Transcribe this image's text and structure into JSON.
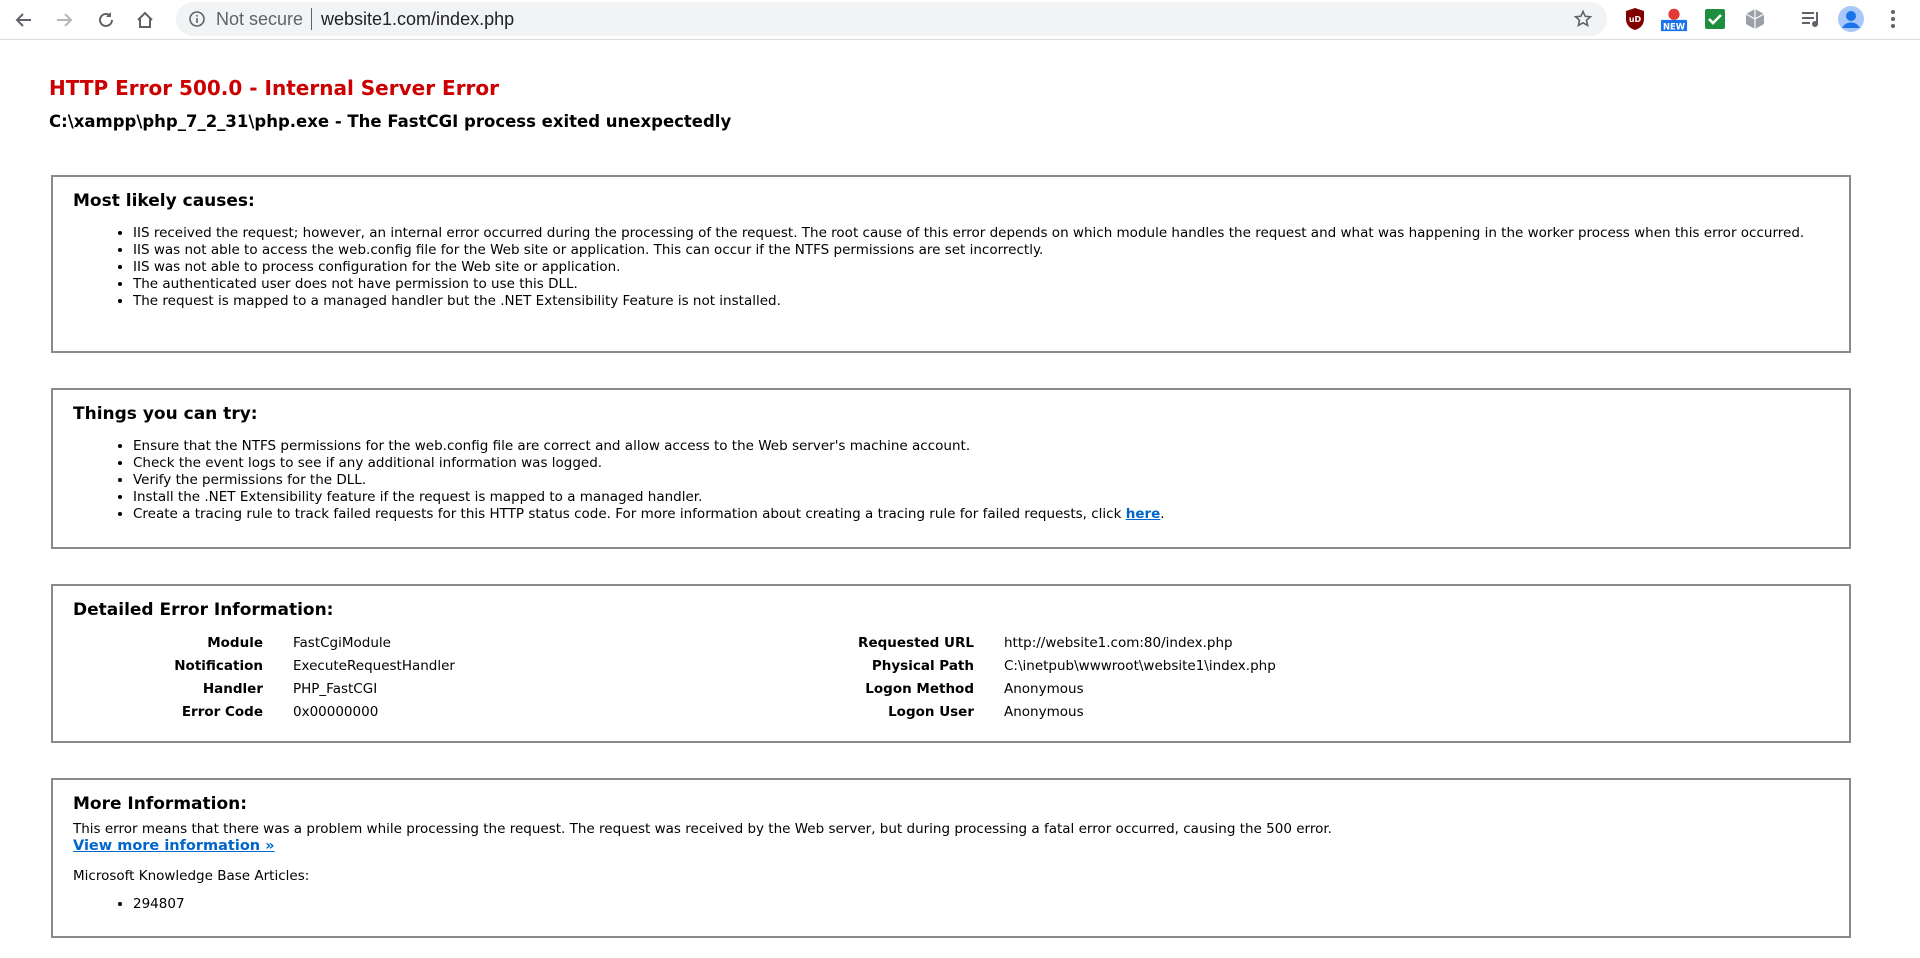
{
  "browser": {
    "omnibox": {
      "security_label": "Not secure",
      "url": "website1.com/index.php"
    },
    "extensions": [
      {
        "name": "ublock-icon"
      },
      {
        "name": "new-badge-icon",
        "badge": "NEW"
      },
      {
        "name": "check-extension-icon"
      },
      {
        "name": "cube-extension-icon"
      },
      {
        "name": "media-queue-icon"
      },
      {
        "name": "profile-avatar-icon"
      }
    ],
    "colors": {
      "accent": "#1a73e8",
      "omnibox_bg": "#f1f3f4"
    }
  },
  "error": {
    "title": "HTTP Error 500.0 - Internal Server Error",
    "subtitle": "C:\\xampp\\php_7_2_31\\php.exe - The FastCGI process exited unexpectedly",
    "title_color": "#cc0000"
  },
  "causes": {
    "heading": "Most likely causes:",
    "items": [
      "IIS received the request; however, an internal error occurred during the processing of the request. The root cause of this error depends on which module handles the request and what was happening in the worker process when this error occurred.",
      "IIS was not able to access the web.config file for the Web site or application. This can occur if the NTFS permissions are set incorrectly.",
      "IIS was not able to process configuration for the Web site or application.",
      "The authenticated user does not have permission to use this DLL.",
      "The request is mapped to a managed handler but the .NET Extensibility Feature is not installed."
    ]
  },
  "tries": {
    "heading": "Things you can try:",
    "items": [
      "Ensure that the NTFS permissions for the web.config file are correct and allow access to the Web server's machine account.",
      "Check the event logs to see if any additional information was logged.",
      "Verify the permissions for the DLL.",
      "Install the .NET Extensibility feature if the request is mapped to a managed handler."
    ],
    "last_item_text": "Create a tracing rule to track failed requests for this HTTP status code. For more information about creating a tracing rule for failed requests, click ",
    "last_item_link": "here",
    "last_item_suffix": "."
  },
  "details": {
    "heading": "Detailed Error Information:",
    "left": [
      {
        "label": "Module",
        "value": "FastCgiModule"
      },
      {
        "label": "Notification",
        "value": "ExecuteRequestHandler"
      },
      {
        "label": "Handler",
        "value": "PHP_FastCGI"
      },
      {
        "label": "Error Code",
        "value": "0x00000000"
      }
    ],
    "right": [
      {
        "label": "Requested URL",
        "value": "http://website1.com:80/index.php"
      },
      {
        "label": "Physical Path",
        "value": "C:\\inetpub\\wwwroot\\website1\\index.php"
      },
      {
        "label": "Logon Method",
        "value": "Anonymous"
      },
      {
        "label": "Logon User",
        "value": "Anonymous"
      }
    ]
  },
  "more": {
    "heading": "More Information:",
    "text": "This error means that there was a problem while processing the request. The request was received by the Web server, but during processing a fatal error occurred, causing the 500 error.",
    "link": "View more information »",
    "kb_label": "Microsoft Knowledge Base Articles:",
    "kb_items": [
      "294807"
    ]
  }
}
